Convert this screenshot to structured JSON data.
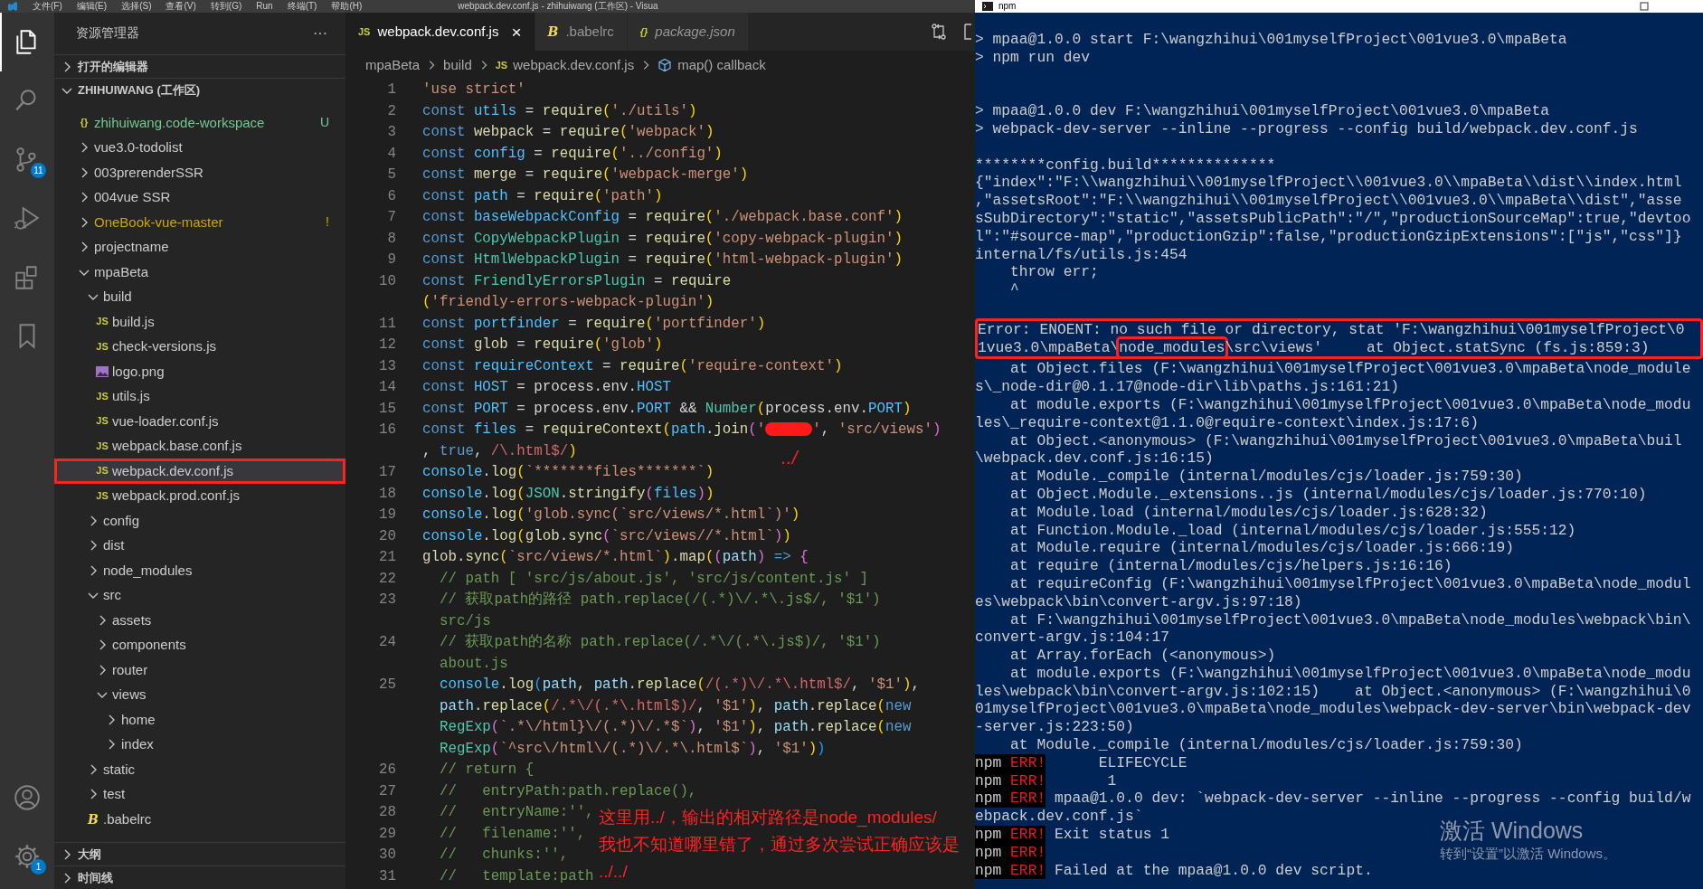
{
  "menu_bar": {
    "items": [
      "文件(F)",
      "编辑(E)",
      "选择(S)",
      "查看(V)",
      "转到(G)",
      "Run",
      "终端(T)",
      "帮助(H)"
    ],
    "title": "webpack.dev.conf.js - zhihuiwang (工作区) - Visua"
  },
  "activity_bar": {
    "items": [
      {
        "kind": "explorer",
        "selected": true
      },
      {
        "kind": "search",
        "selected": false
      },
      {
        "kind": "source_control",
        "selected": false,
        "badge": "11"
      },
      {
        "kind": "run",
        "selected": false
      },
      {
        "kind": "extensions",
        "selected": false
      },
      {
        "kind": "bookmarks",
        "selected": false
      }
    ],
    "bottom": [
      {
        "kind": "account"
      },
      {
        "kind": "settings",
        "badge": "1"
      }
    ]
  },
  "explorer": {
    "title": "资源管理器",
    "more": "···",
    "sections": [
      {
        "label": "打开的编辑器",
        "expanded": false
      },
      {
        "label": "ZHIHUIWANG (工作区)",
        "expanded": true
      }
    ],
    "tree": [
      {
        "label": "zhihuiwang.code-workspace",
        "kind": "workspace",
        "icon_label": "{}",
        "color": "#73c991",
        "badge": "U",
        "selected": false
      },
      {
        "label": "vue3.0-todolist",
        "kind": "folder",
        "expanded": false,
        "selected": false
      },
      {
        "label": "003prerenderSSR",
        "kind": "folder",
        "expanded": false,
        "selected": false
      },
      {
        "label": "004vue SSR",
        "kind": "folder",
        "expanded": false,
        "selected": false
      },
      {
        "label": "OneBook-vue-master",
        "kind": "folder",
        "expanded": false,
        "color": "#cca700",
        "badge": "!",
        "selected": false
      },
      {
        "label": "projectname",
        "kind": "folder",
        "expanded": false,
        "selected": false
      },
      {
        "label": "mpaBeta",
        "kind": "folder",
        "expanded": true,
        "selected": false,
        "children": [
          {
            "label": "build",
            "kind": "folder",
            "expanded": true,
            "selected": false,
            "children": [
              {
                "label": "build.js",
                "kind": "js",
                "icon_label": "JS",
                "selected": false
              },
              {
                "label": "check-versions.js",
                "kind": "js",
                "icon_label": "JS",
                "selected": false
              },
              {
                "label": "logo.png",
                "kind": "image",
                "selected": false
              },
              {
                "label": "utils.js",
                "kind": "js",
                "icon_label": "JS",
                "selected": false
              },
              {
                "label": "vue-loader.conf.js",
                "kind": "js",
                "icon_label": "JS",
                "selected": false
              },
              {
                "label": "webpack.base.conf.js",
                "kind": "js",
                "icon_label": "JS",
                "selected": false
              },
              {
                "label": "webpack.dev.conf.js",
                "kind": "js",
                "icon_label": "JS",
                "selected": true,
                "boxed": true
              },
              {
                "label": "webpack.prod.conf.js",
                "kind": "js",
                "icon_label": "JS",
                "selected": false
              }
            ]
          },
          {
            "label": "config",
            "kind": "folder",
            "expanded": false,
            "selected": false
          },
          {
            "label": "dist",
            "kind": "folder",
            "expanded": false,
            "selected": false
          },
          {
            "label": "node_modules",
            "kind": "folder",
            "expanded": false,
            "selected": false
          },
          {
            "label": "src",
            "kind": "folder",
            "expanded": true,
            "selected": false,
            "children": [
              {
                "label": "assets",
                "kind": "folder",
                "expanded": false,
                "selected": false
              },
              {
                "label": "components",
                "kind": "folder",
                "expanded": false,
                "selected": false
              },
              {
                "label": "router",
                "kind": "folder",
                "expanded": false,
                "selected": false
              },
              {
                "label": "views",
                "kind": "folder",
                "expanded": true,
                "selected": false,
                "children": [
                  {
                    "label": "home",
                    "kind": "folder",
                    "expanded": false,
                    "selected": false
                  },
                  {
                    "label": "index",
                    "kind": "folder",
                    "expanded": false,
                    "selected": false
                  }
                ]
              }
            ]
          },
          {
            "label": "static",
            "kind": "folder",
            "expanded": false,
            "selected": false
          },
          {
            "label": "test",
            "kind": "folder",
            "expanded": false,
            "selected": false
          },
          {
            "label": ".babelrc",
            "kind": "babel",
            "icon_label": "B",
            "selected": false
          }
        ]
      }
    ],
    "bottom_sections": [
      {
        "label": "大纲",
        "expanded": false
      },
      {
        "label": "时间线",
        "expanded": false
      }
    ]
  },
  "editor": {
    "tabs": [
      {
        "label": "webpack.dev.conf.js",
        "kind": "js",
        "icon_label": "JS",
        "selected": true,
        "preview": false,
        "close": "×"
      },
      {
        "label": ".babelrc",
        "kind": "babel",
        "icon_label": "B",
        "selected": false,
        "preview": false
      },
      {
        "label": "package.json",
        "kind": "json",
        "icon_label": "{}",
        "selected": false,
        "preview": true
      }
    ],
    "breadcrumb": [
      {
        "label": "mpaBeta",
        "kind": "folder"
      },
      {
        "label": "build",
        "kind": "folder"
      },
      {
        "label": "webpack.dev.conf.js",
        "kind": "js",
        "icon_label": "JS"
      },
      {
        "label": "map() callback",
        "kind": "symbol"
      }
    ],
    "lines": [
      {
        "number": "1",
        "wraps": [
          {
            "tokens": [
              {
                "kind": "str",
                "text": "'use strict'"
              }
            ]
          }
        ]
      },
      {
        "number": "2",
        "wraps": [
          {
            "tokens": [
              {
                "kind": "kw",
                "text": "const "
              },
              {
                "kind": "const",
                "text": "utils"
              },
              {
                "kind": "pl",
                "text": " = "
              },
              {
                "kind": "fn",
                "text": "require"
              },
              {
                "kind": "br",
                "text": "("
              },
              {
                "kind": "str",
                "text": "'./utils'"
              },
              {
                "kind": "br",
                "text": ")"
              }
            ]
          }
        ]
      },
      {
        "number": "3",
        "wraps": [
          {
            "tokens": [
              {
                "kind": "kw",
                "text": "const "
              },
              {
                "kind": "unused",
                "text": "webpack"
              },
              {
                "kind": "pl",
                "text": " = "
              },
              {
                "kind": "fn",
                "text": "require"
              },
              {
                "kind": "br",
                "text": "("
              },
              {
                "kind": "str",
                "text": "'webpack'"
              },
              {
                "kind": "br",
                "text": ")"
              }
            ]
          }
        ]
      },
      {
        "number": "4",
        "wraps": [
          {
            "tokens": [
              {
                "kind": "kw",
                "text": "const "
              },
              {
                "kind": "const",
                "text": "config"
              },
              {
                "kind": "pl",
                "text": " = "
              },
              {
                "kind": "fn",
                "text": "require"
              },
              {
                "kind": "br",
                "text": "("
              },
              {
                "kind": "str",
                "text": "'../config'"
              },
              {
                "kind": "br",
                "text": ")"
              }
            ]
          }
        ]
      },
      {
        "number": "5",
        "wraps": [
          {
            "tokens": [
              {
                "kind": "kw",
                "text": "const "
              },
              {
                "kind": "unused",
                "text": "merge"
              },
              {
                "kind": "pl",
                "text": " = "
              },
              {
                "kind": "fn",
                "text": "require"
              },
              {
                "kind": "br",
                "text": "("
              },
              {
                "kind": "str",
                "text": "'webpack-merge'"
              },
              {
                "kind": "br",
                "text": ")"
              }
            ]
          }
        ]
      },
      {
        "number": "6",
        "wraps": [
          {
            "tokens": [
              {
                "kind": "kw",
                "text": "const "
              },
              {
                "kind": "const",
                "text": "path"
              },
              {
                "kind": "pl",
                "text": " = "
              },
              {
                "kind": "fn",
                "text": "require"
              },
              {
                "kind": "br",
                "text": "("
              },
              {
                "kind": "str",
                "text": "'path'"
              },
              {
                "kind": "br",
                "text": ")"
              }
            ]
          }
        ]
      },
      {
        "number": "7",
        "wraps": [
          {
            "tokens": [
              {
                "kind": "kw",
                "text": "const "
              },
              {
                "kind": "const",
                "text": "baseWebpackConfig"
              },
              {
                "kind": "pl",
                "text": " = "
              },
              {
                "kind": "fn",
                "text": "require"
              },
              {
                "kind": "br",
                "text": "("
              },
              {
                "kind": "str",
                "text": "'./webpack.base.conf'"
              },
              {
                "kind": "br",
                "text": ")"
              }
            ]
          }
        ]
      },
      {
        "number": "8",
        "wraps": [
          {
            "tokens": [
              {
                "kind": "kw",
                "text": "const "
              },
              {
                "kind": "cls",
                "text": "CopyWebpackPlugin"
              },
              {
                "kind": "pl",
                "text": " = "
              },
              {
                "kind": "fn",
                "text": "require"
              },
              {
                "kind": "br",
                "text": "("
              },
              {
                "kind": "str",
                "text": "'copy-webpack-plugin'"
              },
              {
                "kind": "br",
                "text": ")"
              }
            ]
          }
        ]
      },
      {
        "number": "9",
        "wraps": [
          {
            "tokens": [
              {
                "kind": "kw",
                "text": "const "
              },
              {
                "kind": "cls",
                "text": "HtmlWebpackPlugin"
              },
              {
                "kind": "pl",
                "text": " = "
              },
              {
                "kind": "fn",
                "text": "require"
              },
              {
                "kind": "br",
                "text": "("
              },
              {
                "kind": "str",
                "text": "'html-webpack-plugin'"
              },
              {
                "kind": "br",
                "text": ")"
              }
            ]
          }
        ]
      },
      {
        "number": "10",
        "wraps": [
          {
            "tokens": [
              {
                "kind": "kw",
                "text": "const "
              },
              {
                "kind": "cls",
                "text": "FriendlyErrorsPlugin"
              },
              {
                "kind": "pl",
                "text": " = "
              },
              {
                "kind": "fn",
                "text": "require"
              }
            ]
          },
          {
            "tokens": [
              {
                "kind": "br",
                "text": "("
              },
              {
                "kind": "str",
                "text": "'friendly-errors-webpack-plugin'"
              },
              {
                "kind": "br",
                "text": ")"
              }
            ]
          }
        ]
      },
      {
        "number": "11",
        "wraps": [
          {
            "tokens": [
              {
                "kind": "kw",
                "text": "const "
              },
              {
                "kind": "const",
                "text": "portfinder"
              },
              {
                "kind": "pl",
                "text": " = "
              },
              {
                "kind": "fn",
                "text": "require"
              },
              {
                "kind": "br",
                "text": "("
              },
              {
                "kind": "str",
                "text": "'portfinder'"
              },
              {
                "kind": "br",
                "text": ")"
              }
            ]
          }
        ]
      },
      {
        "number": "12",
        "wraps": [
          {
            "tokens": [
              {
                "kind": "kw",
                "text": "const "
              },
              {
                "kind": "unused",
                "text": "glob"
              },
              {
                "kind": "pl",
                "text": " = "
              },
              {
                "kind": "fn",
                "text": "require"
              },
              {
                "kind": "br",
                "text": "("
              },
              {
                "kind": "str",
                "text": "'glob'"
              },
              {
                "kind": "br",
                "text": ")"
              }
            ]
          }
        ]
      },
      {
        "number": "13",
        "wraps": [
          {
            "tokens": [
              {
                "kind": "kw",
                "text": "const "
              },
              {
                "kind": "const",
                "text": "requireContext"
              },
              {
                "kind": "pl",
                "text": " = "
              },
              {
                "kind": "fn",
                "text": "require"
              },
              {
                "kind": "br",
                "text": "("
              },
              {
                "kind": "str",
                "text": "'require-context'"
              },
              {
                "kind": "br",
                "text": ")"
              }
            ]
          }
        ]
      },
      {
        "number": "14",
        "wraps": [
          {
            "tokens": [
              {
                "kind": "kw",
                "text": "const "
              },
              {
                "kind": "const",
                "text": "HOST"
              },
              {
                "kind": "pl",
                "text": " = process.env."
              },
              {
                "kind": "const",
                "text": "HOST"
              }
            ]
          }
        ]
      },
      {
        "number": "15",
        "wraps": [
          {
            "tokens": [
              {
                "kind": "kw",
                "text": "const "
              },
              {
                "kind": "const",
                "text": "PORT"
              },
              {
                "kind": "pl",
                "text": " = process.env."
              },
              {
                "kind": "const",
                "text": "PORT"
              },
              {
                "kind": "pl",
                "text": " && "
              },
              {
                "kind": "cls",
                "text": "Number"
              },
              {
                "kind": "br",
                "text": "("
              },
              {
                "kind": "pl",
                "text": "process.env."
              },
              {
                "kind": "const",
                "text": "PORT"
              },
              {
                "kind": "br",
                "text": ")"
              }
            ]
          }
        ]
      },
      {
        "number": "16",
        "wraps": [
          {
            "tokens": [
              {
                "kind": "kw",
                "text": "const "
              },
              {
                "kind": "const",
                "text": "files"
              },
              {
                "kind": "pl",
                "text": " = "
              },
              {
                "kind": "fn",
                "text": "requireContext"
              },
              {
                "kind": "br",
                "text": "("
              },
              {
                "kind": "const",
                "text": "path"
              },
              {
                "kind": "pl",
                "text": "."
              },
              {
                "kind": "fn",
                "text": "join"
              },
              {
                "kind": "br2",
                "text": "("
              },
              {
                "kind": "str",
                "text": "'"
              },
              {
                "kind": "redacted"
              },
              {
                "kind": "str",
                "text": "'"
              },
              {
                "kind": "pl",
                "text": ", "
              },
              {
                "kind": "str",
                "text": "'src/views'"
              },
              {
                "kind": "br2",
                "text": ")"
              }
            ]
          },
          {
            "tokens": [
              {
                "kind": "pl",
                "text": ", "
              },
              {
                "kind": "kw",
                "text": "true"
              },
              {
                "kind": "pl",
                "text": ", "
              },
              {
                "kind": "rx",
                "text": "/\\.html$/"
              },
              {
                "kind": "br",
                "text": ")"
              }
            ]
          }
        ]
      },
      {
        "number": "17",
        "wraps": [
          {
            "tokens": [
              {
                "kind": "const",
                "text": "console"
              },
              {
                "kind": "pl",
                "text": "."
              },
              {
                "kind": "fn",
                "text": "log"
              },
              {
                "kind": "br",
                "text": "("
              },
              {
                "kind": "str",
                "text": "`*******files*******`"
              },
              {
                "kind": "br",
                "text": ")"
              }
            ]
          }
        ]
      },
      {
        "number": "18",
        "wraps": [
          {
            "tokens": [
              {
                "kind": "const",
                "text": "console"
              },
              {
                "kind": "pl",
                "text": "."
              },
              {
                "kind": "fn",
                "text": "log"
              },
              {
                "kind": "br",
                "text": "("
              },
              {
                "kind": "cls",
                "text": "JSON"
              },
              {
                "kind": "pl",
                "text": "."
              },
              {
                "kind": "fn",
                "text": "stringify"
              },
              {
                "kind": "br2",
                "text": "("
              },
              {
                "kind": "const",
                "text": "files"
              },
              {
                "kind": "br2",
                "text": ")"
              },
              {
                "kind": "br",
                "text": ")"
              }
            ]
          }
        ]
      },
      {
        "number": "19",
        "wraps": [
          {
            "tokens": [
              {
                "kind": "const",
                "text": "console"
              },
              {
                "kind": "pl",
                "text": "."
              },
              {
                "kind": "fn",
                "text": "log"
              },
              {
                "kind": "br",
                "text": "("
              },
              {
                "kind": "str",
                "text": "'glob.sync(`src/views/*.html`)'"
              },
              {
                "kind": "br",
                "text": ")"
              }
            ]
          }
        ]
      },
      {
        "number": "20",
        "wraps": [
          {
            "tokens": [
              {
                "kind": "const",
                "text": "console"
              },
              {
                "kind": "pl",
                "text": "."
              },
              {
                "kind": "fn",
                "text": "log"
              },
              {
                "kind": "br",
                "text": "("
              },
              {
                "kind": "unused",
                "text": "glob"
              },
              {
                "kind": "pl",
                "text": "."
              },
              {
                "kind": "fn",
                "text": "sync"
              },
              {
                "kind": "br2",
                "text": "("
              },
              {
                "kind": "str",
                "text": "`src/views//*.html`"
              },
              {
                "kind": "br2",
                "text": ")"
              },
              {
                "kind": "br",
                "text": ")"
              }
            ]
          }
        ]
      },
      {
        "number": "21",
        "wraps": [
          {
            "tokens": [
              {
                "kind": "unused",
                "text": "glob"
              },
              {
                "kind": "pl",
                "text": "."
              },
              {
                "kind": "fn",
                "text": "sync"
              },
              {
                "kind": "br",
                "text": "("
              },
              {
                "kind": "str",
                "text": "`src/views/*.html`"
              },
              {
                "kind": "br",
                "text": ")"
              },
              {
                "kind": "pl",
                "text": "."
              },
              {
                "kind": "fn",
                "text": "map"
              },
              {
                "kind": "br",
                "text": "("
              },
              {
                "kind": "br2",
                "text": "("
              },
              {
                "kind": "var",
                "text": "path"
              },
              {
                "kind": "br2",
                "text": ")"
              },
              {
                "kind": "kw",
                "text": " => "
              },
              {
                "kind": "br2",
                "text": "{"
              }
            ]
          }
        ]
      },
      {
        "number": "22",
        "wraps": [
          {
            "tokens": [
              {
                "kind": "cm",
                "text": "  // path [ 'src/js/about.js', 'src/js/content.js' ]"
              }
            ]
          }
        ]
      },
      {
        "number": "23",
        "wraps": [
          {
            "tokens": [
              {
                "kind": "cm",
                "text": "  // 获取path的路径 path.replace(/(.*)\\/.*\\.js$/, '$1')"
              }
            ]
          },
          {
            "tokens": [
              {
                "kind": "cm",
                "text": "  src/js"
              }
            ]
          }
        ]
      },
      {
        "number": "24",
        "wraps": [
          {
            "tokens": [
              {
                "kind": "cm",
                "text": "  // 获取path的名称 path.replace(/.*\\/(.*\\.js$)/, '$1')"
              }
            ]
          },
          {
            "tokens": [
              {
                "kind": "cm",
                "text": "  about.js"
              }
            ]
          }
        ]
      },
      {
        "number": "25",
        "wraps": [
          {
            "tokens": [
              {
                "kind": "const",
                "text": "  console"
              },
              {
                "kind": "pl",
                "text": "."
              },
              {
                "kind": "fn",
                "text": "log"
              },
              {
                "kind": "br3",
                "text": "("
              },
              {
                "kind": "var",
                "text": "path"
              },
              {
                "kind": "pl",
                "text": ", "
              },
              {
                "kind": "var",
                "text": "path"
              },
              {
                "kind": "pl",
                "text": "."
              },
              {
                "kind": "fn",
                "text": "replace"
              },
              {
                "kind": "br",
                "text": "("
              },
              {
                "kind": "rx",
                "text": "/(.*)\\/.*\\.html$/"
              },
              {
                "kind": "pl",
                "text": ", "
              },
              {
                "kind": "str",
                "text": "'$1'"
              },
              {
                "kind": "br",
                "text": ")"
              },
              {
                "kind": "pl",
                "text": ","
              }
            ]
          },
          {
            "tokens": [
              {
                "kind": "var",
                "text": "  path"
              },
              {
                "kind": "pl",
                "text": "."
              },
              {
                "kind": "fn",
                "text": "replace"
              },
              {
                "kind": "br",
                "text": "("
              },
              {
                "kind": "rx",
                "text": "/.*\\/(.*\\.html$)/"
              },
              {
                "kind": "pl",
                "text": ", "
              },
              {
                "kind": "str",
                "text": "'$1'"
              },
              {
                "kind": "br",
                "text": ")"
              },
              {
                "kind": "pl",
                "text": ", "
              },
              {
                "kind": "var",
                "text": "path"
              },
              {
                "kind": "pl",
                "text": "."
              },
              {
                "kind": "fn",
                "text": "replace"
              },
              {
                "kind": "br",
                "text": "("
              },
              {
                "kind": "kw",
                "text": "new"
              }
            ]
          },
          {
            "tokens": [
              {
                "kind": "cls",
                "text": "  RegExp"
              },
              {
                "kind": "br2",
                "text": "("
              },
              {
                "kind": "str",
                "text": "`.*\\/html}\\/(.*)\\/.*$`"
              },
              {
                "kind": "br2",
                "text": ")"
              },
              {
                "kind": "pl",
                "text": ", "
              },
              {
                "kind": "str",
                "text": "'$1'"
              },
              {
                "kind": "br",
                "text": ")"
              },
              {
                "kind": "pl",
                "text": ", "
              },
              {
                "kind": "var",
                "text": "path"
              },
              {
                "kind": "pl",
                "text": "."
              },
              {
                "kind": "fn",
                "text": "replace"
              },
              {
                "kind": "br",
                "text": "("
              },
              {
                "kind": "kw",
                "text": "new"
              }
            ]
          },
          {
            "tokens": [
              {
                "kind": "cls",
                "text": "  RegExp"
              },
              {
                "kind": "br2",
                "text": "("
              },
              {
                "kind": "str",
                "text": "`^src\\/html\\/(.*)\\/.*\\.html$`"
              },
              {
                "kind": "br2",
                "text": ")"
              },
              {
                "kind": "pl",
                "text": ", "
              },
              {
                "kind": "str",
                "text": "'$1'"
              },
              {
                "kind": "br",
                "text": ")"
              },
              {
                "kind": "br3",
                "text": ")"
              }
            ]
          }
        ]
      },
      {
        "number": "26",
        "wraps": [
          {
            "tokens": [
              {
                "kind": "cm",
                "text": "  // return {"
              }
            ]
          }
        ]
      },
      {
        "number": "27",
        "wraps": [
          {
            "tokens": [
              {
                "kind": "cm",
                "text": "  //   entryPath:path.replace(),"
              }
            ]
          }
        ]
      },
      {
        "number": "28",
        "wraps": [
          {
            "tokens": [
              {
                "kind": "cm",
                "text": "  //   entryName:'',"
              }
            ]
          }
        ]
      },
      {
        "number": "29",
        "wraps": [
          {
            "tokens": [
              {
                "kind": "cm",
                "text": "  //   filename:'',"
              }
            ]
          }
        ]
      },
      {
        "number": "30",
        "wraps": [
          {
            "tokens": [
              {
                "kind": "cm",
                "text": "  //   chunks:'',"
              }
            ]
          }
        ]
      },
      {
        "number": "31",
        "wraps": [
          {
            "tokens": [
              {
                "kind": "cm",
                "text": "  //   template:path"
              }
            ]
          }
        ]
      }
    ]
  },
  "terminal": {
    "title": "npm",
    "lines": [
      {
        "kind": "out",
        "text": "> mpaa@1.0.0 start F:\\wangzhihui\\001myselfProject\\001vue3.0\\mpaBeta"
      },
      {
        "kind": "out",
        "text": "> npm run dev"
      },
      {
        "kind": "blank"
      },
      {
        "kind": "blank"
      },
      {
        "kind": "out",
        "text": "> mpaa@1.0.0 dev F:\\wangzhihui\\001myselfProject\\001vue3.0\\mpaBeta"
      },
      {
        "kind": "out",
        "text": "> webpack-dev-server --inline --progress --config build/webpack.dev.conf.js"
      },
      {
        "kind": "blank"
      },
      {
        "kind": "out",
        "text": "********config.build**************"
      },
      {
        "kind": "out",
        "text": "{\"index\":\"F:\\\\wangzhihui\\\\001myselfProject\\\\001vue3.0\\\\mpaBeta\\\\dist\\\\index.html"
      },
      {
        "kind": "out",
        "text": ",\"assetsRoot\":\"F:\\\\wangzhihui\\\\001myselfProject\\\\001vue3.0\\\\mpaBeta\\\\dist\",\"asse"
      },
      {
        "kind": "out",
        "text": "sSubDirectory\":\"static\",\"assetsPublicPath\":\"/\",\"productionSourceMap\":true,\"devtoo"
      },
      {
        "kind": "out",
        "text": "l\":\"#source-map\",\"productionGzip\":false,\"productionGzipExtensions\":[\"js\",\"css\"]}"
      },
      {
        "kind": "out",
        "text": "internal/fs/utils.js:454"
      },
      {
        "kind": "out",
        "text": "    throw err;"
      },
      {
        "kind": "out",
        "text": "    ^"
      },
      {
        "kind": "blank"
      },
      {
        "kind": "group",
        "boxed": true,
        "lines": [
          {
            "kind": "out",
            "text": "Error: ENOENT: no such file or directory, stat 'F:\\wangzhihui\\001myselfProject\\0"
          },
          {
            "kind": "out",
            "parts": [
              {
                "text": "1vue3.0\\mpaBeta\\",
                "boxed": false
              },
              {
                "text": "node_modules",
                "boxed": true
              },
              {
                "text": "\\src\\views'     at Object.statSync (fs.js:859:3)",
                "boxed": false
              }
            ]
          }
        ]
      },
      {
        "kind": "out",
        "text": "    at Object.files (F:\\wangzhihui\\001myselfProject\\001vue3.0\\mpaBeta\\node_module"
      },
      {
        "kind": "out",
        "text": "s\\_node-dir@0.1.17@node-dir\\lib\\paths.js:161:21)"
      },
      {
        "kind": "out",
        "text": "    at module.exports (F:\\wangzhihui\\001myselfProject\\001vue3.0\\mpaBeta\\node_modu"
      },
      {
        "kind": "out",
        "text": "les\\_require-context@1.1.0@require-context\\index.js:17:6)"
      },
      {
        "kind": "out",
        "text": "    at Object.<anonymous> (F:\\wangzhihui\\001myselfProject\\001vue3.0\\mpaBeta\\buil"
      },
      {
        "kind": "out",
        "text": "\\webpack.dev.conf.js:16:15)"
      },
      {
        "kind": "out",
        "text": "    at Module._compile (internal/modules/cjs/loader.js:759:30)"
      },
      {
        "kind": "out",
        "text": "    at Object.Module._extensions..js (internal/modules/cjs/loader.js:770:10)"
      },
      {
        "kind": "out",
        "text": "    at Module.load (internal/modules/cjs/loader.js:628:32)"
      },
      {
        "kind": "out",
        "text": "    at Function.Module._load (internal/modules/cjs/loader.js:555:12)"
      },
      {
        "kind": "out",
        "text": "    at Module.require (internal/modules/cjs/loader.js:666:19)"
      },
      {
        "kind": "out",
        "text": "    at require (internal/modules/cjs/helpers.js:16:16)"
      },
      {
        "kind": "out",
        "text": "    at requireConfig (F:\\wangzhihui\\001myselfProject\\001vue3.0\\mpaBeta\\node_modul"
      },
      {
        "kind": "out",
        "text": "es\\webpack\\bin\\convert-argv.js:97:18)"
      },
      {
        "kind": "out",
        "text": "    at F:\\wangzhihui\\001myselfProject\\001vue3.0\\mpaBeta\\node_modules\\webpack\\bin\\"
      },
      {
        "kind": "out",
        "text": "convert-argv.js:104:17"
      },
      {
        "kind": "out",
        "text": "    at Array.forEach (<anonymous>)"
      },
      {
        "kind": "out",
        "text": "    at module.exports (F:\\wangzhihui\\001myselfProject\\001vue3.0\\mpaBeta\\node_modu"
      },
      {
        "kind": "out",
        "text": "les\\webpack\\bin\\convert-argv.js:102:15)    at Object.<anonymous> (F:\\wangzhihui\\0"
      },
      {
        "kind": "out",
        "text": "01myselfProject\\001vue3.0\\mpaBeta\\node_modules\\webpack-dev-server\\bin\\webpack-dev"
      },
      {
        "kind": "out",
        "text": "-server.js:223:50)"
      },
      {
        "kind": "out",
        "text": "    at Module._compile (internal/modules/cjs/loader.js:759:30)"
      },
      {
        "kind": "err",
        "prefix": "npm",
        "tag": "ERR!",
        "text": "      ELIFECYCLE"
      },
      {
        "kind": "err",
        "prefix": "npm",
        "tag": "ERR!",
        "text": "       1"
      },
      {
        "kind": "err",
        "prefix": "npm",
        "tag": "ERR!",
        "text": " mpaa@1.0.0 dev: `webpack-dev-server --inline --progress --config build/w"
      },
      {
        "kind": "out",
        "text": "ebpack.dev.conf.js`"
      },
      {
        "kind": "err",
        "prefix": "npm",
        "tag": "ERR!",
        "text": " Exit status 1"
      },
      {
        "kind": "err",
        "prefix": "npm",
        "tag": "ERR!"
      },
      {
        "kind": "err",
        "prefix": "npm",
        "tag": "ERR!",
        "text": " Failed at the mpaa@1.0.0 dev script."
      }
    ]
  },
  "annotations": {
    "mark": "../",
    "note": [
      "这里用../，输出的相对路径是node_modules/",
      "我也不知道哪里错了，通过多次尝试正确应该是",
      "../../"
    ]
  },
  "os_notice": {
    "title": "激活 Windows",
    "text": "转到“设置”以激活 Windows。"
  }
}
